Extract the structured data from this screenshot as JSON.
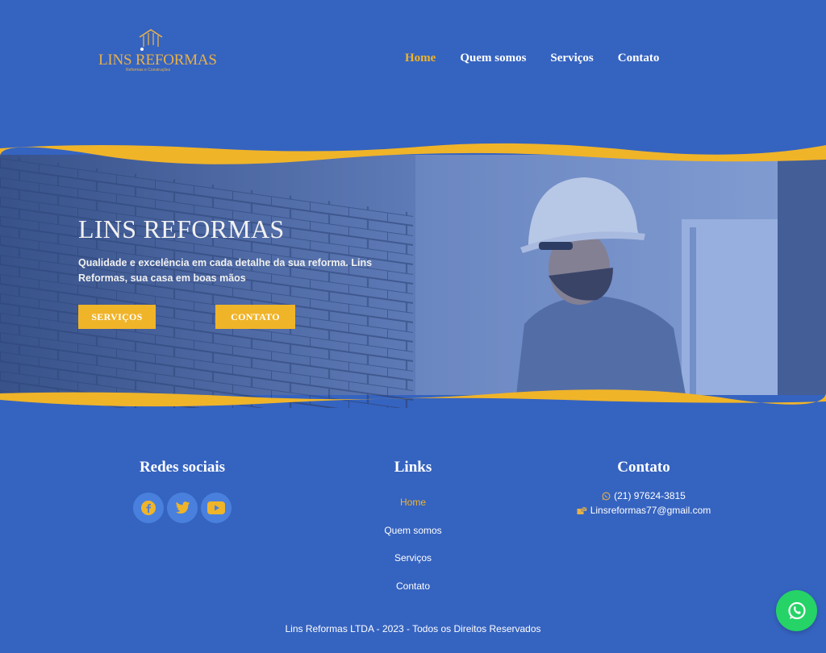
{
  "header": {
    "logo_text": "LINS REFORMAS",
    "logo_subtext": "Reformas e Construções",
    "nav": [
      {
        "label": "Home",
        "active": true
      },
      {
        "label": "Quem somos",
        "active": false
      },
      {
        "label": "Serviços",
        "active": false
      },
      {
        "label": "Contato",
        "active": false
      }
    ]
  },
  "hero": {
    "title": "LINS REFORMAS",
    "subtitle": "Qualidade e excelência em cada detalhe da sua reforma. Lins Reformas, sua casa em boas mãos",
    "buttons": {
      "servicos": "SERVIÇOS",
      "contato": "CONTATO"
    }
  },
  "footer": {
    "social": {
      "title": "Redes sociais",
      "icons": [
        "facebook-icon",
        "twitter-icon",
        "youtube-icon"
      ]
    },
    "links": {
      "title": "Links",
      "items": [
        "Home",
        "Quem somos",
        "Serviços",
        "Contato"
      ]
    },
    "contact": {
      "title": "Contato",
      "phone": "(21) 97624-3815",
      "email": "Linsreformas77@gmail.com"
    },
    "copyright": "Lins Reformas LTDA - 2023 - Todos os Direitos Reservados"
  },
  "colors": {
    "background": "#3563c0",
    "accent": "#f0b429",
    "social_circle": "#4a80dd",
    "whatsapp": "#25d366"
  },
  "floating": {
    "whatsapp_icon": "whatsapp-icon"
  }
}
